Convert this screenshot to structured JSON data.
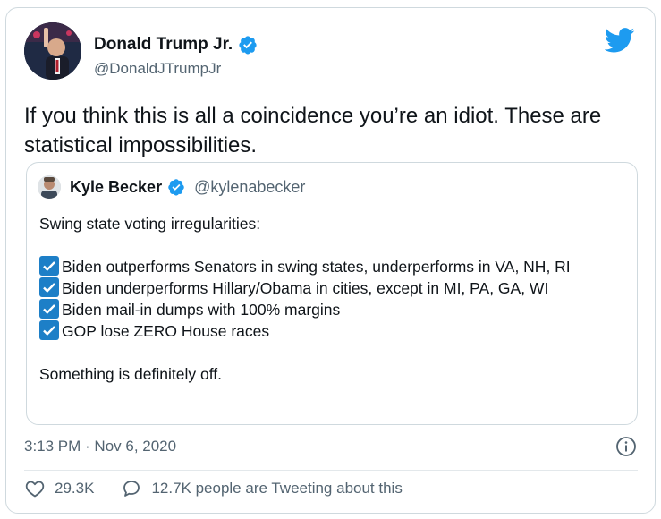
{
  "tweet": {
    "author_name": "Donald Trump Jr.",
    "author_handle": "@DonaldJTrumpJr",
    "text": "If you think this is all a coincidence you’re an idiot. These are statistical impossibilities.",
    "timestamp": "3:13 PM · Nov 6, 2020",
    "likes": "29.3K",
    "conversation": "12.7K people are Tweeting about this"
  },
  "quote": {
    "author_name": "Kyle Becker",
    "author_handle": "@kylenabecker",
    "intro": "Swing state voting irregularities:",
    "items": [
      "Biden outperforms Senators in swing states, underperforms in VA, NH, RI",
      "Biden underperforms Hillary/Obama in cities, except in MI, PA, GA, WI",
      "Biden mail-in dumps with 100% margins",
      "GOP lose ZERO House races"
    ],
    "outro": "Something is definitely off."
  },
  "colors": {
    "twitter_blue": "#1d9bf0",
    "verified": "#1d9bf0",
    "muted_text": "#536471",
    "check_box": "#1d7fc7"
  },
  "icons": {
    "brand": "twitter-bird-icon",
    "verified": "verified-badge-icon",
    "info": "info-icon",
    "like": "heart-icon",
    "reply": "speech-bubble-icon",
    "check": "checkmark-box-icon"
  }
}
